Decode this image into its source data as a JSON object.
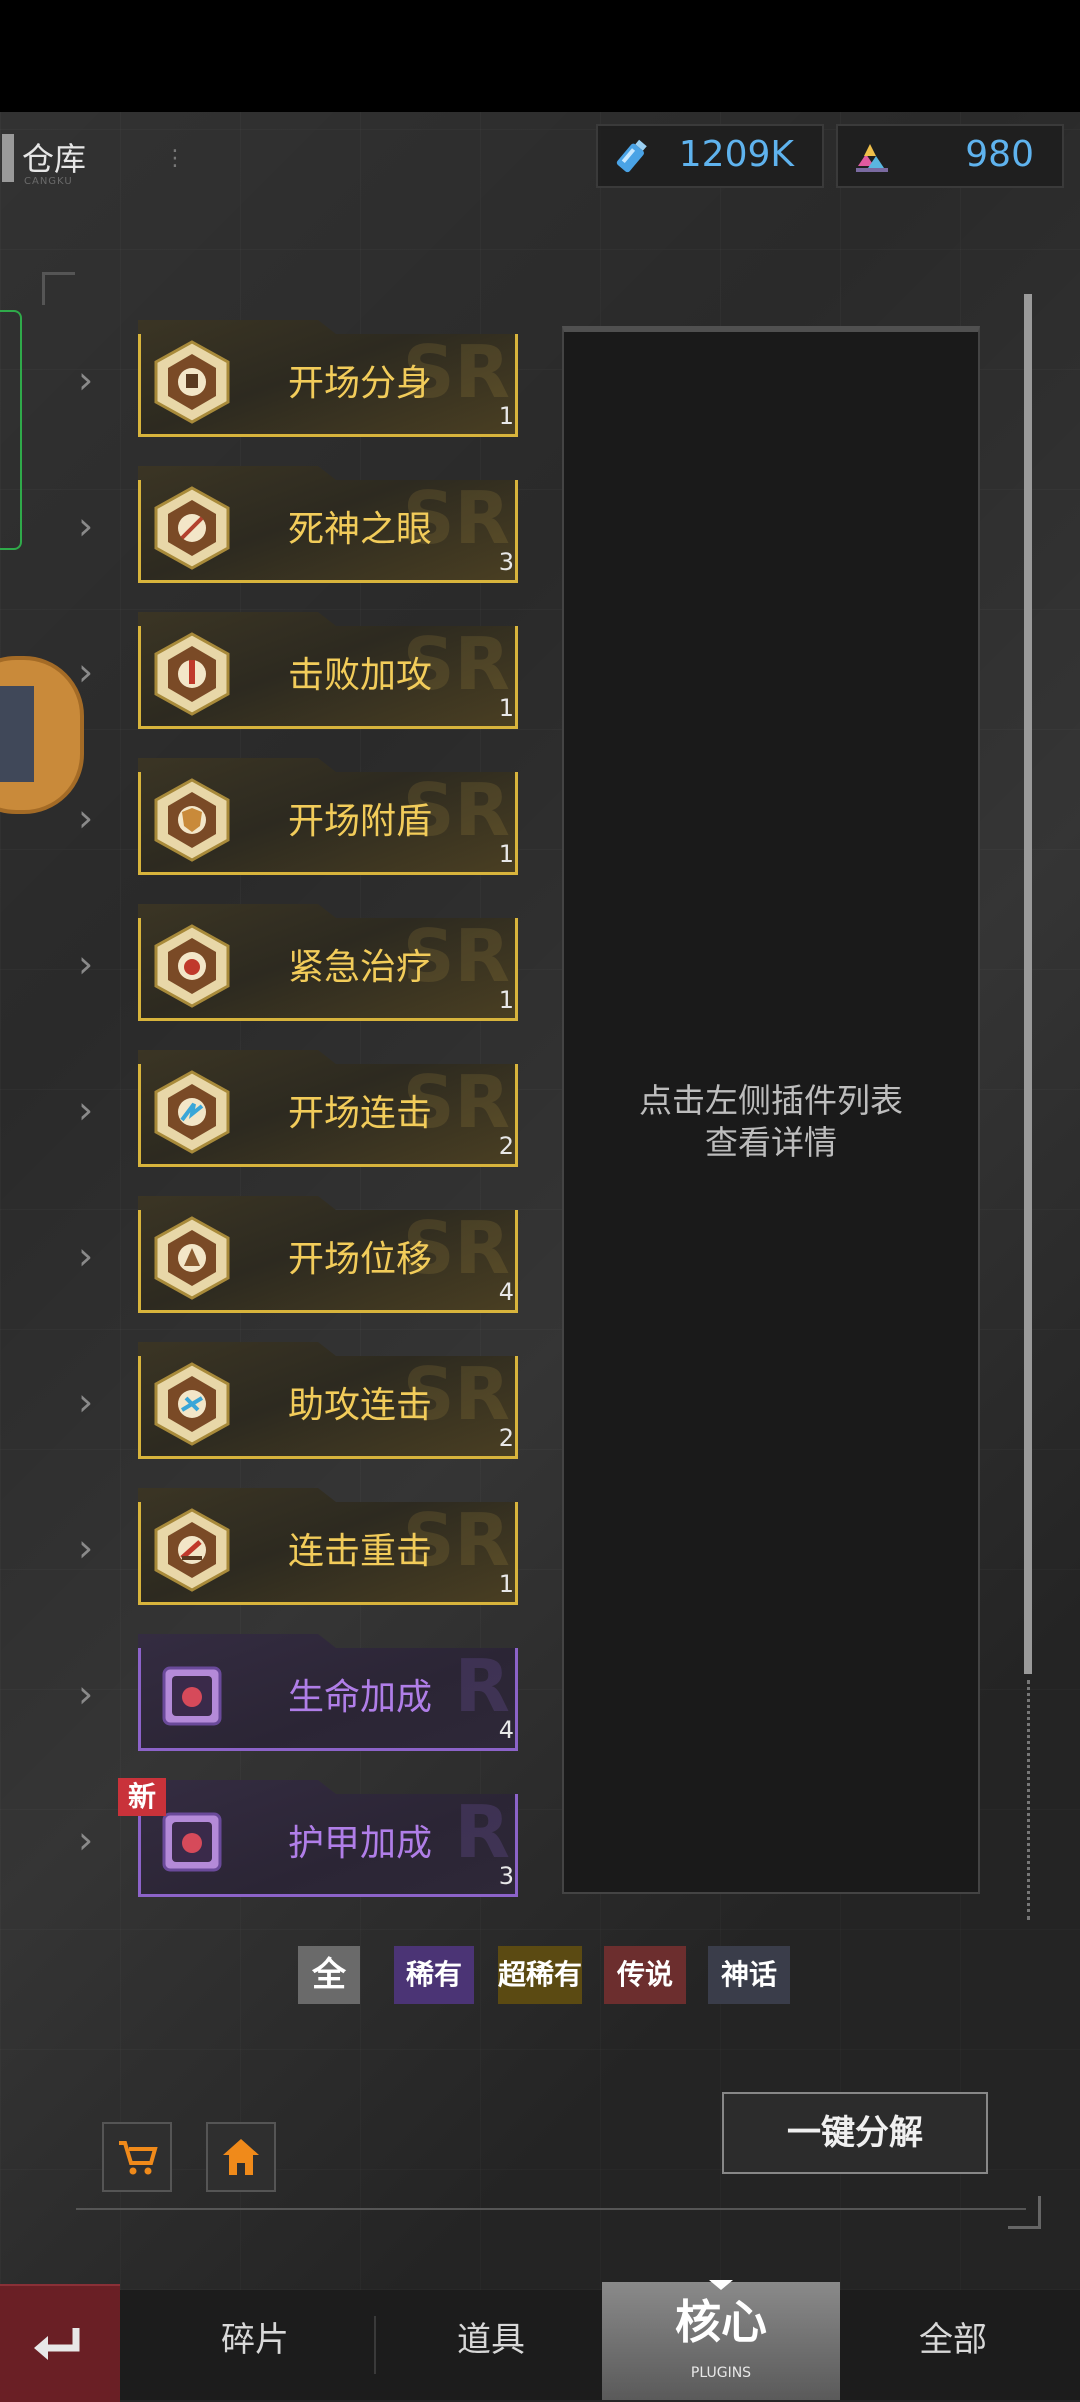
{
  "header": {
    "title": "仓库",
    "title_sub": "CANGKU",
    "menu_glyph": "⋮"
  },
  "resources": [
    {
      "icon": "potion-bottle-icon",
      "value": "1209K"
    },
    {
      "icon": "gem-pile-icon",
      "value": "980"
    }
  ],
  "plugins": [
    {
      "name": "开场分身",
      "count": "1",
      "rarity": "gold",
      "watermark": "SR"
    },
    {
      "name": "死神之眼",
      "count": "3",
      "rarity": "gold",
      "watermark": "SR"
    },
    {
      "name": "击败加攻",
      "count": "1",
      "rarity": "gold",
      "watermark": "SR"
    },
    {
      "name": "开场附盾",
      "count": "1",
      "rarity": "gold",
      "watermark": "SR"
    },
    {
      "name": "紧急治疗",
      "count": "1",
      "rarity": "gold",
      "watermark": "SR"
    },
    {
      "name": "开场连击",
      "count": "2",
      "rarity": "gold",
      "watermark": "SR"
    },
    {
      "name": "开场位移",
      "count": "4",
      "rarity": "gold",
      "watermark": "SR"
    },
    {
      "name": "助攻连击",
      "count": "2",
      "rarity": "gold",
      "watermark": "SR"
    },
    {
      "name": "连击重击",
      "count": "1",
      "rarity": "gold",
      "watermark": "SR"
    },
    {
      "name": "生命加成",
      "count": "4",
      "rarity": "purple",
      "watermark": "R"
    },
    {
      "name": "护甲加成",
      "count": "3",
      "rarity": "purple",
      "watermark": "R",
      "new_label": "新"
    }
  ],
  "detail": {
    "hint_line1": "点击左侧插件列表",
    "hint_line2": "查看详情"
  },
  "filters": {
    "all": "全",
    "rare": "稀有",
    "super_rare": "超稀有",
    "legendary": "传说",
    "mythic": "神话"
  },
  "actions": {
    "salvage_all": "一键分解"
  },
  "tabs": {
    "fragments": "碎片",
    "items": "道具",
    "core": "核心",
    "core_sub": "PLUGINS",
    "all": "全部"
  },
  "colors": {
    "gold": "#d8b43c",
    "purple": "#8c63c9",
    "resource_text": "#5fb3ee",
    "back_button": "#6a1f25"
  }
}
